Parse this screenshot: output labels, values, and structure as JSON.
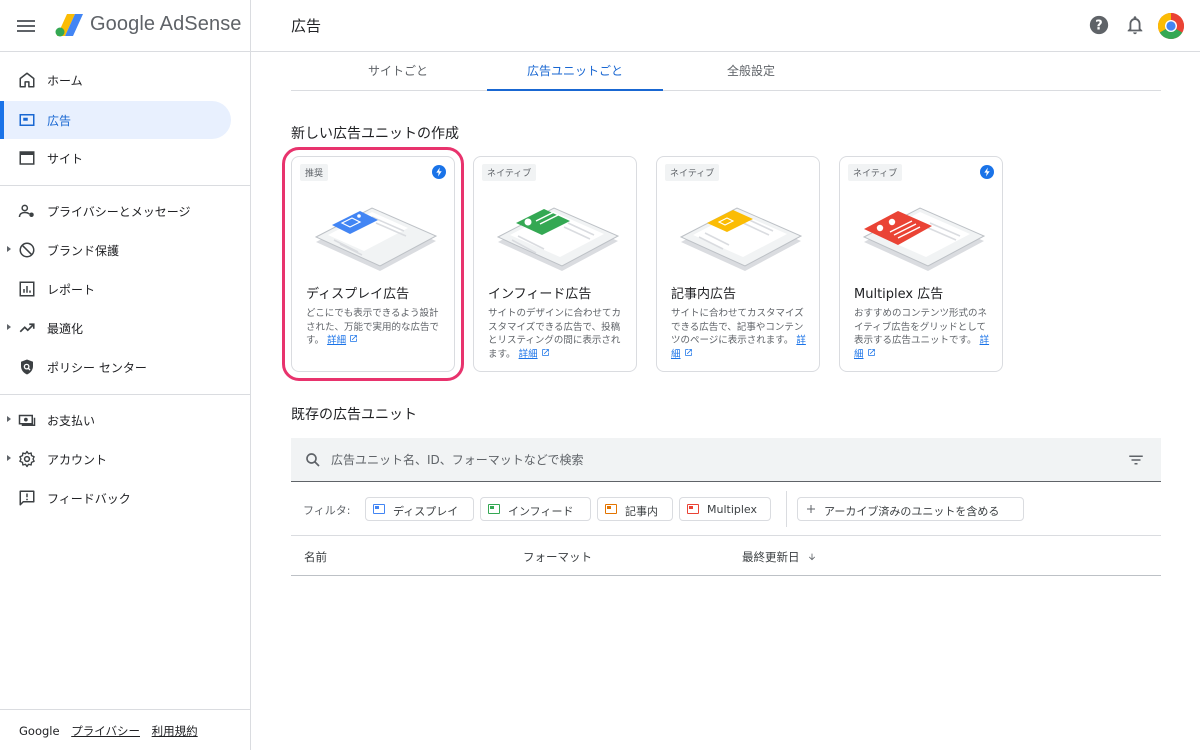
{
  "header": {
    "brand": "Google AdSense",
    "page_title": "広告",
    "icons": [
      "menu-icon",
      "adsense-logo",
      "help-icon",
      "notifications-icon",
      "chrome-avatar"
    ]
  },
  "sidebar": {
    "items": [
      {
        "label": "ホーム",
        "icon": "home-icon"
      },
      {
        "label": "広告",
        "icon": "ads-icon",
        "active": true
      },
      {
        "label": "サイト",
        "icon": "sites-icon"
      },
      {
        "label": "プライバシーとメッセージ",
        "icon": "privacy-icon"
      },
      {
        "label": "ブランド保護",
        "icon": "block-icon"
      },
      {
        "label": "レポート",
        "icon": "reports-icon"
      },
      {
        "label": "最適化",
        "icon": "trending-icon"
      },
      {
        "label": "ポリシー センター",
        "icon": "policy-shield-icon"
      },
      {
        "label": "お支払い",
        "icon": "payments-icon"
      },
      {
        "label": "アカウント",
        "icon": "settings-icon"
      },
      {
        "label": "フィードバック",
        "icon": "feedback-icon"
      }
    ],
    "footer": {
      "google": "Google",
      "privacy": "プライバシー",
      "terms": "利用規約"
    }
  },
  "tabs": [
    {
      "label": "サイトごと"
    },
    {
      "label": "広告ユニットごと",
      "active": true
    },
    {
      "label": "全般設定"
    }
  ],
  "create_section": {
    "title": "新しい広告ユニットの作成",
    "cards": [
      {
        "badge": "推奨",
        "bolt": true,
        "title": "ディスプレイ広告",
        "desc": "どこにでも表示できるよう設計された、万能で実用的な広告です。",
        "link": "詳細",
        "accent": "#4285f4"
      },
      {
        "badge": "ネイティブ",
        "bolt": false,
        "title": "インフィード広告",
        "desc": "サイトのデザインに合わせてカスタマイズできる広告で、投稿とリスティングの間に表示されます。",
        "link": "詳細",
        "accent": "#34a853"
      },
      {
        "badge": "ネイティブ",
        "bolt": false,
        "title": "記事内広告",
        "desc": "サイトに合わせてカスタマイズできる広告で、記事やコンテンツのページに表示されます。",
        "link": "詳細",
        "accent": "#fbbc04"
      },
      {
        "badge": "ネイティブ",
        "bolt": true,
        "title": "Multiplex 広告",
        "desc": "おすすめのコンテンツ形式のネイティブ広告をグリッドとして表示する広告ユニットです。",
        "link": "詳細",
        "accent": "#ea4335"
      }
    ]
  },
  "existing_section": {
    "title": "既存の広告ユニット",
    "search_placeholder": "広告ユニット名、ID、フォーマットなどで検索",
    "filter_label": "フィルタ:",
    "chips": [
      {
        "label": "ディスプレイ",
        "color": "#4285f4"
      },
      {
        "label": "インフィード",
        "color": "#34a853"
      },
      {
        "label": "記事内",
        "color": "#e37400"
      },
      {
        "label": "Multiplex",
        "color": "#ea4335"
      }
    ],
    "archive_chip": "アーカイブ済みのユニットを含める",
    "columns": [
      "名前",
      "フォーマット",
      "最終更新日"
    ]
  }
}
